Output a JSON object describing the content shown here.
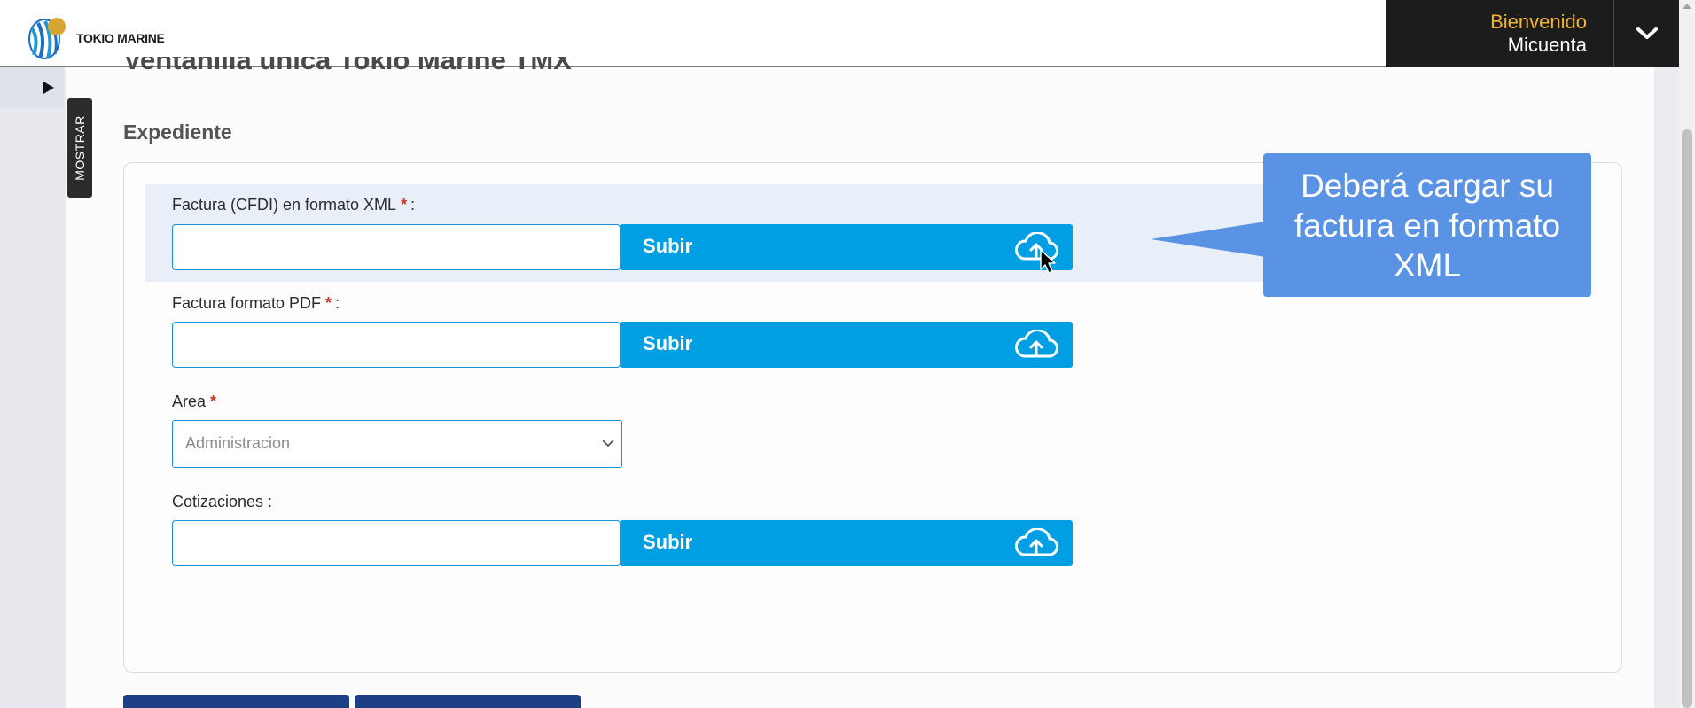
{
  "header": {
    "logo_text": "TOKIO MARINE",
    "welcome": "Bienvenido",
    "account": "Micuenta"
  },
  "sidebar": {
    "toggle_label": "MOSTRAR"
  },
  "page": {
    "title": "Ventanilla única Tokio Marine TMX",
    "section": "Expediente"
  },
  "form": {
    "xml": {
      "label": "Factura (CFDI) en formato XML",
      "required": "*",
      "suffix": ":",
      "button": "Subir",
      "value": ""
    },
    "pdf": {
      "label": "Factura formato PDF",
      "required": "*",
      "suffix": ":",
      "button": "Subir",
      "value": ""
    },
    "area": {
      "label": "Area",
      "required": "*",
      "selected": "Administracion"
    },
    "cotizaciones": {
      "label": "Cotizaciones :",
      "button": "Subir",
      "value": ""
    }
  },
  "callout": {
    "text": "Deberá cargar su factura en formato XML"
  },
  "colors": {
    "upload_button": "#009ee3",
    "callout": "#5b93e4",
    "welcome": "#f2b431",
    "required": "#c0392b",
    "header_user_bg": "#1c1c1c",
    "bottom_buttons": "#1c3f86"
  },
  "icons": {
    "upload": "cloud-upload-icon",
    "dropdown": "chevron-down-icon",
    "sidebar_toggle": "caret-right-icon"
  }
}
